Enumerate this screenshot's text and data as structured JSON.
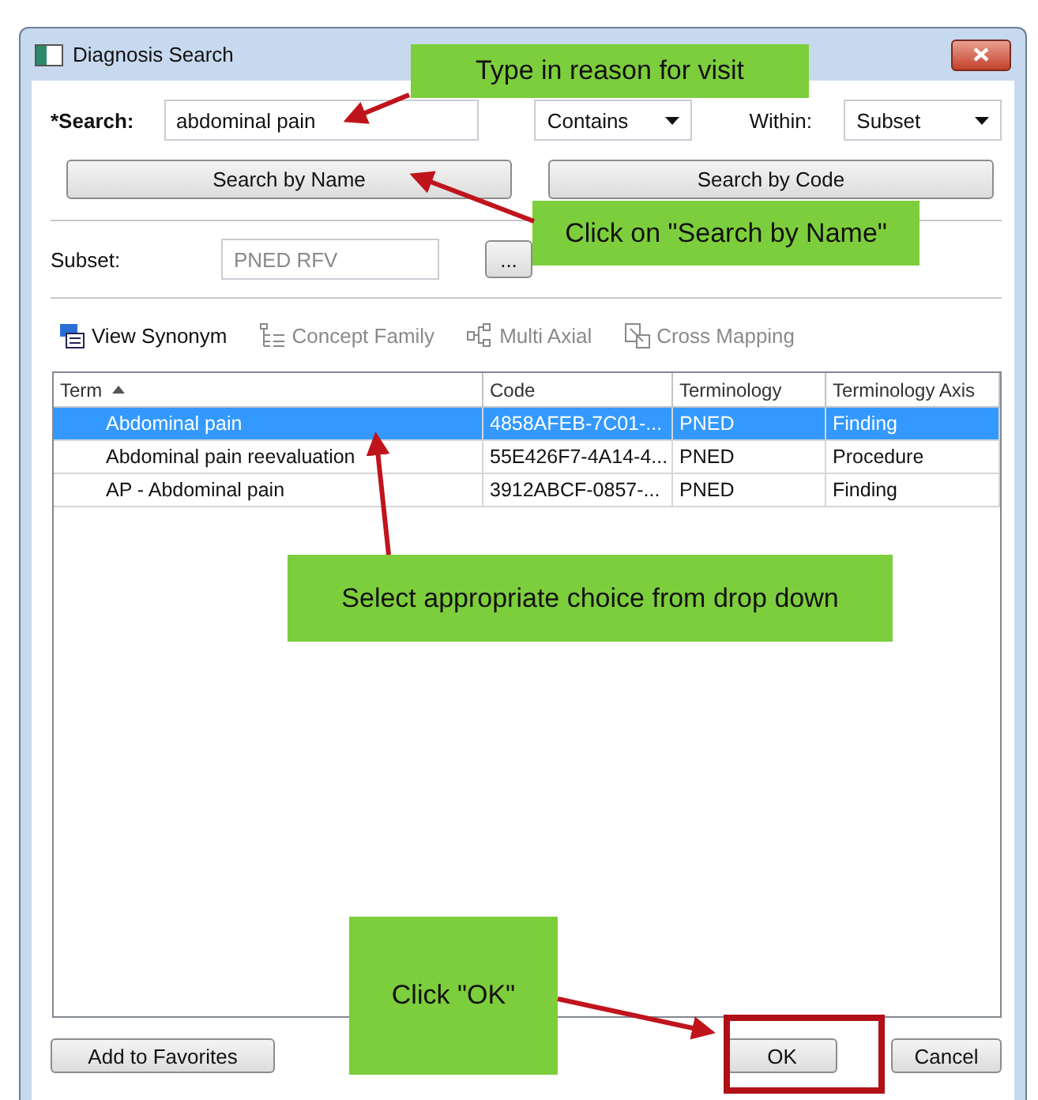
{
  "window": {
    "title": "Diagnosis Search"
  },
  "search": {
    "label": "*Search:",
    "value": "abdominal pain",
    "match": "Contains",
    "within_label": "Within:",
    "within": "Subset"
  },
  "search_buttons": [
    "Search by Name",
    "Search by Code"
  ],
  "subset": {
    "label": "Subset:",
    "value": "PNED RFV",
    "disabled": true,
    "browse": "..."
  },
  "toolbar": [
    {
      "label": "View Synonym",
      "disabled": false
    },
    {
      "label": "Concept Family",
      "disabled": true
    },
    {
      "label": "Multi Axial",
      "disabled": true
    },
    {
      "label": "Cross Mapping",
      "disabled": true
    }
  ],
  "table": {
    "columns": [
      "Term",
      "Code",
      "Terminology",
      "Terminology Axis"
    ],
    "rows": [
      {
        "cells": [
          "Abdominal pain",
          "4858AFEB-7C01-...",
          "PNED",
          "Finding"
        ],
        "selected": true
      },
      {
        "cells": [
          "Abdominal pain reevaluation",
          "55E426F7-4A14-4...",
          "PNED",
          "Procedure"
        ],
        "selected": false
      },
      {
        "cells": [
          "AP - Abdominal pain",
          "3912ABCF-0857-...",
          "PNED",
          "Finding"
        ],
        "selected": false
      }
    ]
  },
  "footer": {
    "favorites": "Add to Favorites",
    "ok": "OK",
    "ok_highlighted": true,
    "cancel": "Cancel"
  },
  "callouts": [
    "Type in reason for visit",
    "Click on \"Search by Name\"",
    "Select appropriate choice from drop down",
    "Click \"OK\""
  ]
}
